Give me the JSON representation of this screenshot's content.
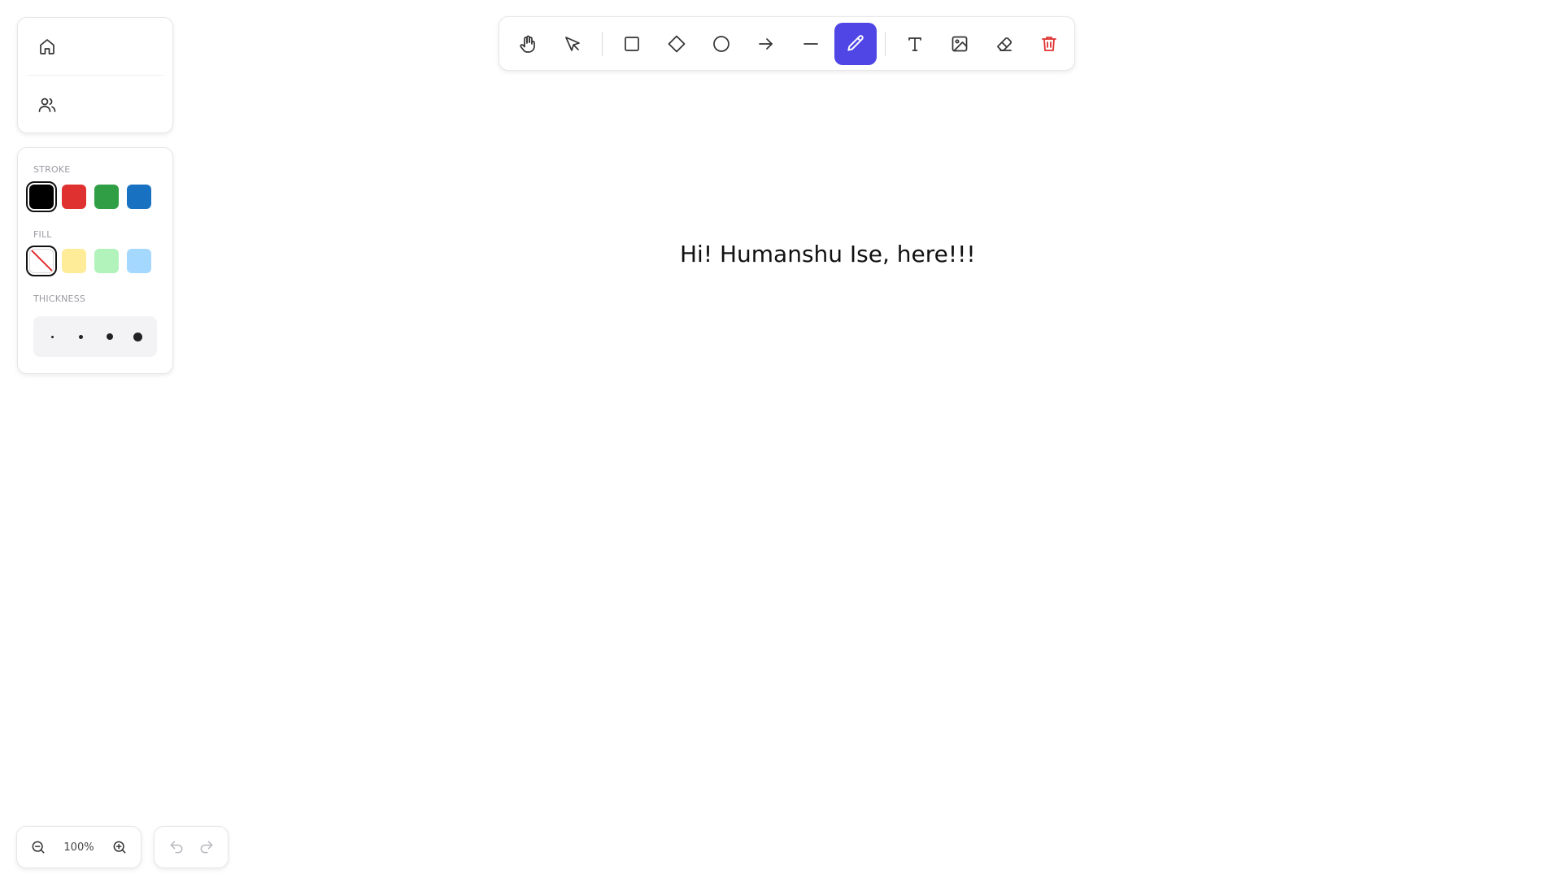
{
  "nav": {
    "items": [
      {
        "icon": "home-icon"
      },
      {
        "icon": "users-icon"
      }
    ]
  },
  "style_panel": {
    "stroke_label": "STROKE",
    "fill_label": "FILL",
    "thickness_label": "THICKNESS",
    "stroke_colors": [
      "#000000",
      "#e03131",
      "#2f9e44",
      "#1971c2"
    ],
    "stroke_selected": "#000000",
    "fill_colors": [
      "none",
      "#ffec99",
      "#b2f2bb",
      "#a5d8ff"
    ],
    "fill_selected": "none",
    "thickness_options": 4
  },
  "toolbar": {
    "tools": [
      "hand-icon",
      "select-icon",
      "rectangle-icon",
      "diamond-icon",
      "ellipse-icon",
      "arrow-icon",
      "line-icon",
      "pencil-icon",
      "text-icon",
      "image-icon",
      "eraser-icon",
      "trash-icon"
    ],
    "active_tool": "pencil-icon",
    "accent": "#5046e5",
    "danger": "#e03131"
  },
  "canvas": {
    "text": "Hi! Humanshu Ise, here!!!"
  },
  "zoom": {
    "level": "100%"
  }
}
